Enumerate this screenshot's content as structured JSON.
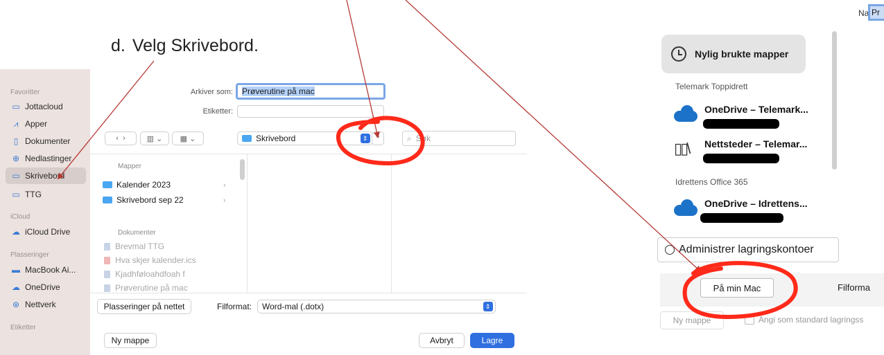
{
  "instruction": {
    "step": "d.",
    "text": "Velg Skrivebord."
  },
  "sidebar": {
    "favorites_head": "Favoritter",
    "favorites": [
      {
        "label": "Jottacloud",
        "icon": "folder-icon"
      },
      {
        "label": "Apper",
        "icon": "apps-icon"
      },
      {
        "label": "Dokumenter",
        "icon": "document-icon"
      },
      {
        "label": "Nedlastinger",
        "icon": "download-icon"
      },
      {
        "label": "Skrivebord",
        "icon": "desktop-icon",
        "selected": true
      },
      {
        "label": "TTG",
        "icon": "folder-icon"
      }
    ],
    "icloud_head": "iCloud",
    "icloud": [
      {
        "label": "iCloud Drive",
        "icon": "cloud-icon"
      }
    ],
    "locations_head": "Plasseringer",
    "locations": [
      {
        "label": "MacBook Ai...",
        "icon": "laptop-icon"
      },
      {
        "label": "OneDrive",
        "icon": "cloud-icon"
      },
      {
        "label": "Nettverk",
        "icon": "network-icon"
      }
    ],
    "tags_head": "Etiketter"
  },
  "dialog": {
    "save_as_label": "Arkiver som:",
    "save_as_value": "Prøverutine på mac",
    "tags_label": "Etiketter:",
    "location_value": "Skrivebord",
    "search_placeholder": "Søk",
    "folders_head": "Mapper",
    "folders": [
      "Kalender 2023",
      "Skrivebord sep 22"
    ],
    "documents_head": "Dokumenter",
    "documents": [
      "Brevmal TTG",
      "Hva skjer kalender.ics",
      "Kjadhføloahdfoah f",
      "Prøverutine på mac"
    ],
    "online_locations_button": "Plasseringer på nettet",
    "format_label": "Filformat:",
    "format_value": "Word-mal (.dotx)",
    "new_folder_button": "Ny mappe",
    "cancel_button": "Avbryt",
    "save_button": "Lagre"
  },
  "panel": {
    "name_label": "Navn:",
    "name_value": "Pr",
    "recent_folders": "Nylig brukte mapper",
    "groups": [
      {
        "title": "Telemark Toppidrett",
        "accounts": [
          "OneDrive – Telemark...",
          "Nettsteder – Telemar..."
        ]
      },
      {
        "title": "Idrettens Office 365",
        "accounts": [
          "OneDrive – Idrettens..."
        ]
      }
    ],
    "manage_accounts_button": "Administrer lagringskontoer",
    "on_my_mac_button": "På min Mac",
    "file_format_label": "Filforma",
    "new_folder_button": "Ny mappe",
    "default_location_label": "Angi som standard lagringss"
  },
  "colors": {
    "accent": "#2f6fe0",
    "annotation_red": "#ff2a1a",
    "arrow": "#b53a35"
  }
}
